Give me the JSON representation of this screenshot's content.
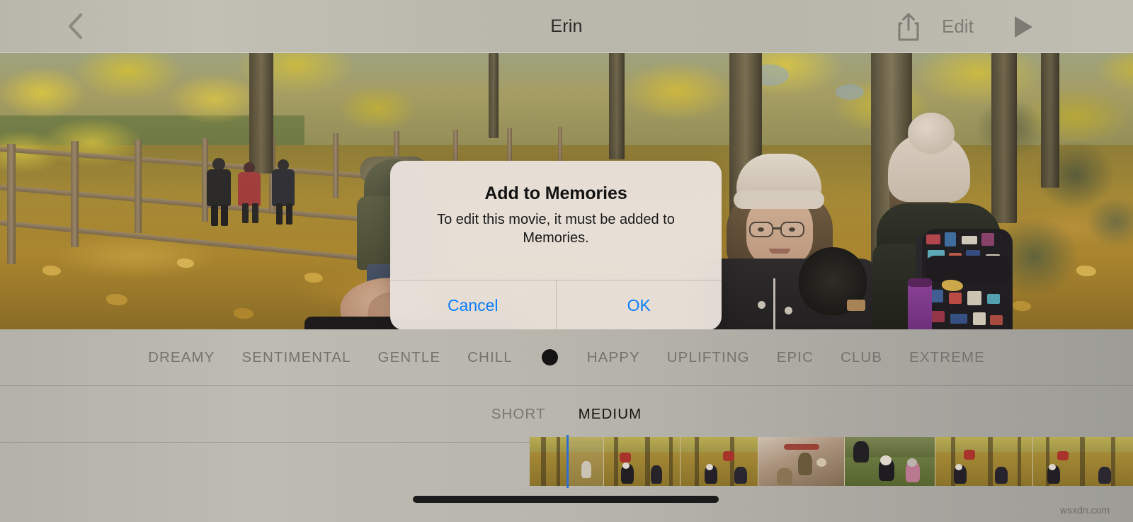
{
  "navbar": {
    "back_icon": "chevron-left-icon",
    "title": "Erin",
    "share_icon": "share-icon",
    "edit_label": "Edit",
    "play_icon": "play-icon"
  },
  "alert": {
    "title": "Add to Memories",
    "message": "To edit this movie, it must be added to Memories.",
    "cancel_label": "Cancel",
    "ok_label": "OK",
    "accent_color": "#0a7cff"
  },
  "moods": {
    "items": [
      {
        "label": "DREAMY",
        "selected": false
      },
      {
        "label": "SENTIMENTAL",
        "selected": false
      },
      {
        "label": "GENTLE",
        "selected": false
      },
      {
        "label": "CHILL",
        "selected": false
      },
      {
        "label": "HAPPY",
        "selected": false
      },
      {
        "label": "UPLIFTING",
        "selected": false
      },
      {
        "label": "EPIC",
        "selected": false
      },
      {
        "label": "CLUB",
        "selected": false
      },
      {
        "label": "EXTREME",
        "selected": false
      }
    ],
    "selected_indicator": "filled-dot",
    "indicator_color": "#141414"
  },
  "lengths": {
    "items": [
      {
        "label": "SHORT",
        "selected": false
      },
      {
        "label": "MEDIUM",
        "selected": true
      }
    ]
  },
  "timeline": {
    "playhead_color": "#2f6fd0",
    "frames": [
      {
        "scene": "autumn-woods-path"
      },
      {
        "scene": "kids-in-leaves"
      },
      {
        "scene": "kids-in-leaves"
      },
      {
        "scene": "indoor-market-stall"
      },
      {
        "scene": "children-on-grass"
      },
      {
        "scene": "kids-in-leaves"
      },
      {
        "scene": "kids-in-leaves"
      }
    ]
  },
  "photo": {
    "description": "Autumn woodland walk with wooden fence, fallen yellow leaves, walkers on path"
  },
  "watermark": "wsxdn.com"
}
